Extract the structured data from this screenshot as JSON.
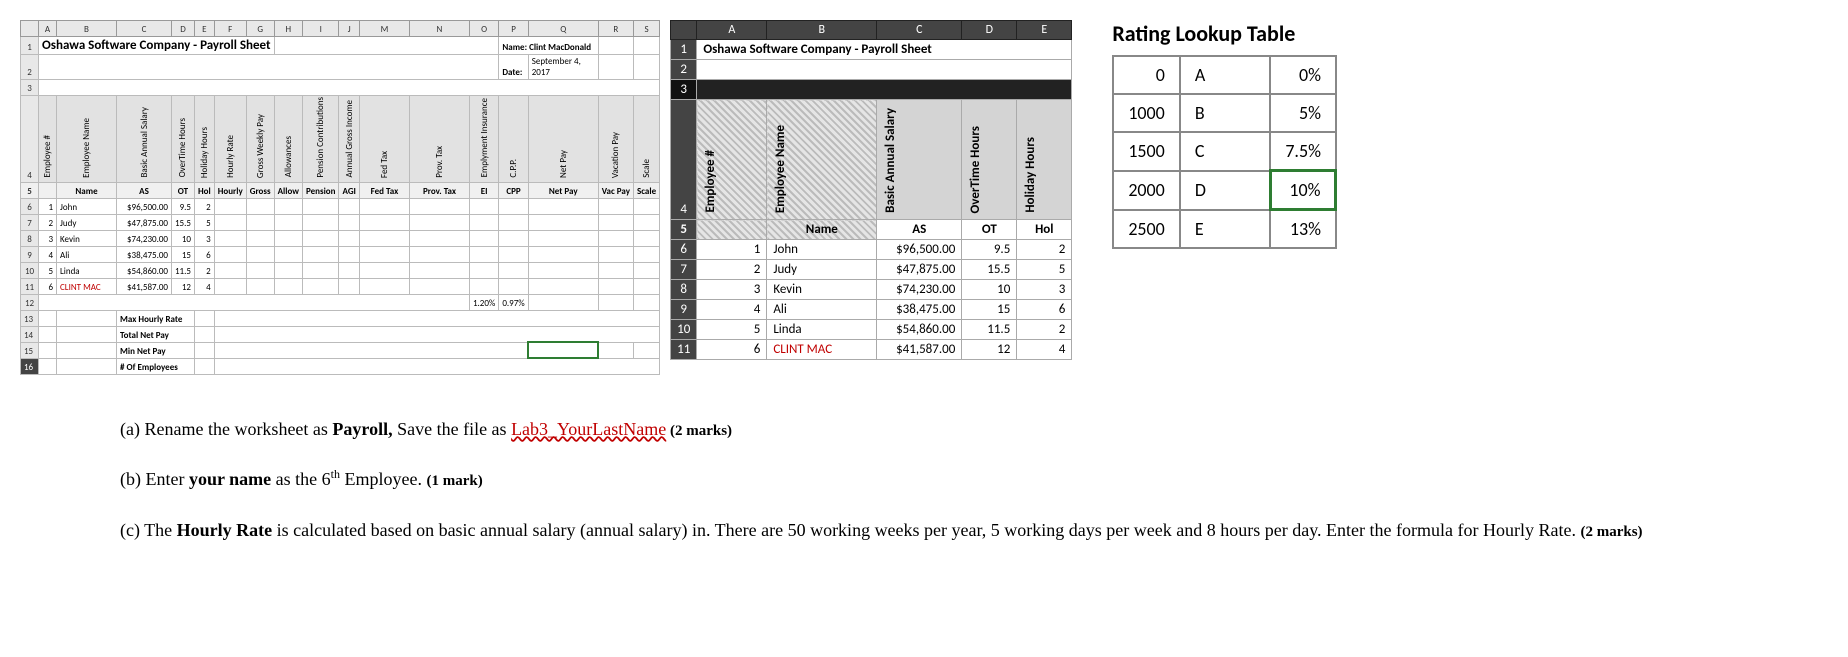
{
  "sheet_title": "Oshawa Software Company - Payroll Sheet",
  "p1": {
    "cols": [
      "A",
      "B",
      "C",
      "D",
      "E",
      "F",
      "G",
      "H",
      "I",
      "J",
      "M",
      "N",
      "O",
      "P",
      "Q",
      "R",
      "S"
    ],
    "name_lbl": "Name: Clint MacDonald",
    "date_lbl": "Date:",
    "date_val": "September 4, 2017",
    "headers": [
      "Employee #",
      "Employee Name",
      "Basic Annual Salary",
      "OverTime Hours",
      "Holiday Hours",
      "Hourly Rate",
      "Gross Weekly Pay",
      "Allowances",
      "Pension Contributions",
      "Annual Gross Income",
      "Fed Tax",
      "Prov. Tax",
      "Emplyment Insurance",
      "C.P.P.",
      "Net Pay",
      "Vacation Pay",
      "Scale"
    ],
    "short": [
      "",
      "Name",
      "AS",
      "OT",
      "Hol",
      "Hourly",
      "Gross",
      "Allow",
      "Pension",
      "AGI",
      "Fed Tax",
      "Prov. Tax",
      "EI",
      "CPP",
      "Net Pay",
      "Vac Pay",
      "Scale"
    ],
    "rows": [
      {
        "n": "1",
        "name": "John",
        "as": "$96,500.00",
        "ot": "9.5",
        "hol": "2"
      },
      {
        "n": "2",
        "name": "Judy",
        "as": "$47,875.00",
        "ot": "15.5",
        "hol": "5"
      },
      {
        "n": "3",
        "name": "Kevin",
        "as": "$74,230.00",
        "ot": "10",
        "hol": "3"
      },
      {
        "n": "4",
        "name": "Ali",
        "as": "$38,475.00",
        "ot": "15",
        "hol": "6"
      },
      {
        "n": "5",
        "name": "Linda",
        "as": "$54,860.00",
        "ot": "11.5",
        "hol": "2"
      },
      {
        "n": "6",
        "name": "CLINT MAC",
        "as": "$41,587.00",
        "ot": "12",
        "hol": "4"
      }
    ],
    "ei_pct": "1.20%",
    "cpp_pct": "0.97%",
    "summary": [
      "Max Hourly Rate",
      "Total Net Pay",
      "Min Net Pay",
      "# Of Employees"
    ]
  },
  "p2": {
    "cols": [
      "A",
      "B",
      "C",
      "D",
      "E"
    ],
    "headers": [
      "Employee #",
      "Employee Name",
      "Basic Annual Salary",
      "OverTime Hours",
      "Holiday Hours"
    ],
    "short": [
      "",
      "Name",
      "AS",
      "OT",
      "Hol"
    ],
    "rows": [
      {
        "r": "6",
        "n": "1",
        "name": "John",
        "as": "$96,500.00",
        "ot": "9.5",
        "hol": "2"
      },
      {
        "r": "7",
        "n": "2",
        "name": "Judy",
        "as": "$47,875.00",
        "ot": "15.5",
        "hol": "5"
      },
      {
        "r": "8",
        "n": "3",
        "name": "Kevin",
        "as": "$74,230.00",
        "ot": "10",
        "hol": "3"
      },
      {
        "r": "9",
        "n": "4",
        "name": "Ali",
        "as": "$38,475.00",
        "ot": "15",
        "hol": "6"
      },
      {
        "r": "10",
        "n": "5",
        "name": "Linda",
        "as": "$54,860.00",
        "ot": "11.5",
        "hol": "2"
      },
      {
        "r": "11",
        "n": "6",
        "name": "CLINT MAC",
        "as": "$41,587.00",
        "ot": "12",
        "hol": "4"
      }
    ]
  },
  "lookup": {
    "title": "Rating Lookup Table",
    "rows": [
      {
        "v": "0",
        "g": "A",
        "p": "0%"
      },
      {
        "v": "1000",
        "g": "B",
        "p": "5%"
      },
      {
        "v": "1500",
        "g": "C",
        "p": "7.5%"
      },
      {
        "v": "2000",
        "g": "D",
        "p": "10%"
      },
      {
        "v": "2500",
        "g": "E",
        "p": "13%"
      }
    ]
  },
  "instr": {
    "a_pre": "(a)  Rename the worksheet as ",
    "a_bold": "Payroll, ",
    "a_mid": "Save the file as ",
    "a_file": "Lab3_YourLastName",
    "a_marks": " (2 marks)",
    "b_pre": "(b)  Enter ",
    "b_bold": "your name",
    "b_mid": " as the 6",
    "b_sup": "th",
    "b_end": " Employee. ",
    "b_marks": "(1 mark)",
    "c_pre": "(c)  The ",
    "c_bold": "Hourly Rate",
    "c_mid": " is calculated based on basic annual salary (annual salary) in. There are 50 working weeks per year, 5 working days per week and 8 hours per day. Enter the formula for Hourly Rate. ",
    "c_marks": "(2 marks)"
  },
  "chart_data": {
    "type": "table",
    "title": "Oshawa Software Company - Payroll Sheet",
    "employees": [
      {
        "id": 1,
        "name": "John",
        "basic_annual_salary": 96500.0,
        "overtime_hours": 9.5,
        "holiday_hours": 2
      },
      {
        "id": 2,
        "name": "Judy",
        "basic_annual_salary": 47875.0,
        "overtime_hours": 15.5,
        "holiday_hours": 5
      },
      {
        "id": 3,
        "name": "Kevin",
        "basic_annual_salary": 74230.0,
        "overtime_hours": 10,
        "holiday_hours": 3
      },
      {
        "id": 4,
        "name": "Ali",
        "basic_annual_salary": 38475.0,
        "overtime_hours": 15,
        "holiday_hours": 6
      },
      {
        "id": 5,
        "name": "Linda",
        "basic_annual_salary": 54860.0,
        "overtime_hours": 11.5,
        "holiday_hours": 2
      },
      {
        "id": 6,
        "name": "CLINT MAC",
        "basic_annual_salary": 41587.0,
        "overtime_hours": 12,
        "holiday_hours": 4
      }
    ],
    "constants": {
      "ei_rate": 0.012,
      "cpp_rate": 0.0097
    },
    "rating_lookup": [
      {
        "threshold": 0,
        "grade": "A",
        "rate": 0.0
      },
      {
        "threshold": 1000,
        "grade": "B",
        "rate": 0.05
      },
      {
        "threshold": 1500,
        "grade": "C",
        "rate": 0.075
      },
      {
        "threshold": 2000,
        "grade": "D",
        "rate": 0.1
      },
      {
        "threshold": 2500,
        "grade": "E",
        "rate": 0.13
      }
    ]
  }
}
